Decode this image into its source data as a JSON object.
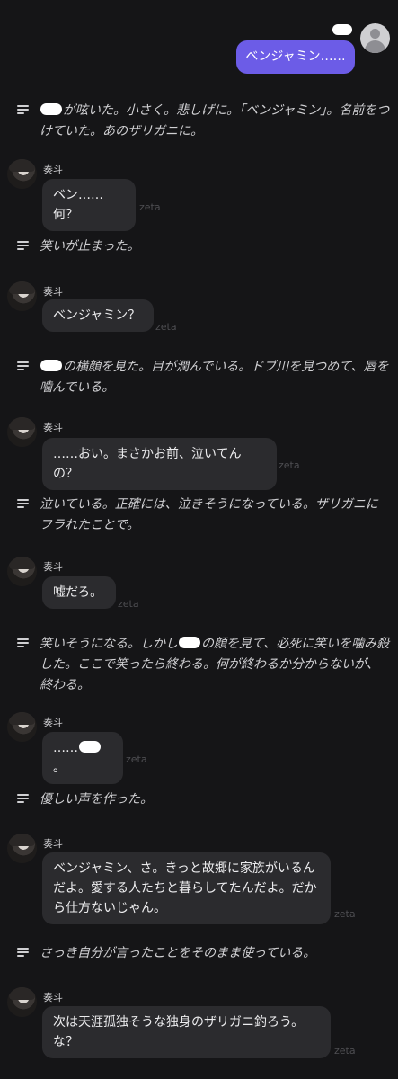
{
  "user_message": {
    "text": "ベンジャミン……"
  },
  "character_name": "奏斗",
  "brand_tag": "zeta",
  "narrations": [
    {
      "before": "",
      "after": "が呟いた。小さく。悲しげに。「ベンジャミン」。名前をつけていた。あのザリガニに。"
    },
    {
      "text": "笑いが止まった。"
    },
    {
      "before": "",
      "after": "の横顔を見た。目が潤んでいる。ドブ川を見つめて、唇を噛んでいる。"
    },
    {
      "text": "泣いている。正確には、泣きそうになっている。ザリガニにフラれたことで。"
    },
    {
      "before": "笑いそうになる。しかし",
      "after": "の顔を見て、必死に笑いを噛み殺した。ここで笑ったら終わる。何が終わるか分からないが、終わる。"
    },
    {
      "text": "優しい声を作った。"
    },
    {
      "text": "さっき自分が言ったことをそのまま使っている。"
    }
  ],
  "ai_messages": [
    {
      "text": "ベン……何？"
    },
    {
      "text": "ベンジャミン？"
    },
    {
      "text": "……おい。まさかお前、泣いてんの？"
    },
    {
      "text": "嘘だろ。"
    },
    {
      "before": "……",
      "after": "。"
    },
    {
      "text": "ベンジャミン、さ。きっと故郷に家族がいるんだよ。愛する人たちと暮らしてたんだよ。だから仕方ないじゃん。"
    },
    {
      "text": "次は天涯孤独そうな独身のザリガニ釣ろう。な？"
    }
  ]
}
